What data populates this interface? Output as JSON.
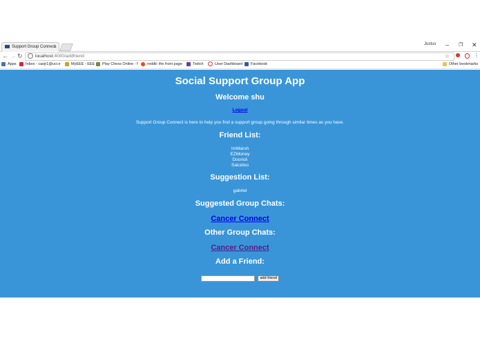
{
  "browser": {
    "tab_title": "Support Group Connect",
    "user_name": "Justus",
    "url_host": "localhost",
    "url_path": ":4000/addfriend",
    "bookmarks": [
      "Apps",
      "Inbox - caojr1@uci.e",
      "MyEEE - EEE",
      "Play Chess Online - f",
      "reddit: the front page",
      "Twitch",
      "User Dashboard",
      "Facebook"
    ],
    "other_bookmarks": "Other bookmarks"
  },
  "page": {
    "title": "Social Support Group App",
    "welcome": "Welcome shu",
    "logout": "Logout",
    "intro": "Support Group Connect is here to help you find a support group going through similar times as you have.",
    "friend_heading": "Friend List:",
    "friends": [
      "ImMarsh",
      "EZMoney",
      "Doorick",
      "Salcidoo"
    ],
    "suggestion_heading": "Suggestion List:",
    "suggestions": [
      "gabriel"
    ],
    "suggested_chats_heading": "Suggested Group Chats:",
    "suggested_chat": "Cancer Connect",
    "other_chats_heading": "Other Group Chats:",
    "other_chat": "Cancer Connect",
    "add_heading": "Add a Friend:",
    "friend_input_value": "",
    "add_button": "add friend"
  },
  "colors": {
    "page_bg": "#3a95d8",
    "link": "#0000ee",
    "visited_link": "#551a8b"
  }
}
